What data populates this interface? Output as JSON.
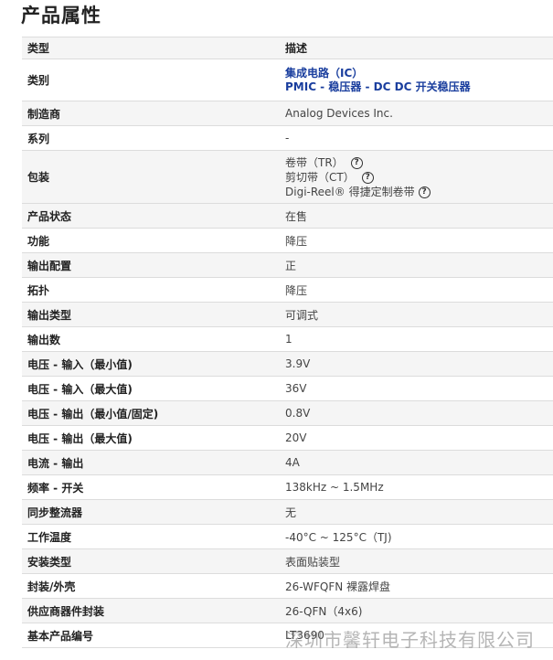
{
  "title": "产品属性",
  "header": {
    "type": "类型",
    "desc": "描述"
  },
  "category": {
    "label": "类别",
    "link1": "集成电路（IC）",
    "link2": "PMIC - 稳压器 - DC DC 开关稳压器"
  },
  "manufacturer": {
    "label": "制造商",
    "value": "Analog Devices Inc."
  },
  "series": {
    "label": "系列",
    "value": "-"
  },
  "packaging": {
    "label": "包装",
    "opt1": "卷带（TR）",
    "opt2": "剪切带（CT）",
    "opt3": "Digi-Reel® 得捷定制卷带"
  },
  "rows": [
    {
      "label": "产品状态",
      "value": "在售"
    },
    {
      "label": "功能",
      "value": "降压"
    },
    {
      "label": "输出配置",
      "value": "正"
    },
    {
      "label": "拓扑",
      "value": "降压"
    },
    {
      "label": "输出类型",
      "value": "可调式"
    },
    {
      "label": "输出数",
      "value": "1"
    },
    {
      "label": "电压 - 输入（最小值)",
      "value": "3.9V"
    },
    {
      "label": "电压 - 输入（最大值)",
      "value": "36V"
    },
    {
      "label": "电压 - 输出（最小值/固定)",
      "value": "0.8V"
    },
    {
      "label": "电压 - 输出（最大值)",
      "value": "20V"
    },
    {
      "label": "电流 - 输出",
      "value": "4A"
    },
    {
      "label": "频率 - 开关",
      "value": "138kHz ~ 1.5MHz"
    },
    {
      "label": "同步整流器",
      "value": "无"
    },
    {
      "label": "工作温度",
      "value": "-40°C ~ 125°C（TJ)"
    },
    {
      "label": "安装类型",
      "value": "表面贴装型"
    },
    {
      "label": "封装/外壳",
      "value": "26-WFQFN 裸露焊盘"
    },
    {
      "label": "供应商器件封装",
      "value": "26-QFN（4x6)"
    },
    {
      "label": "基本产品编号",
      "value": "LT3690"
    }
  ],
  "watermark": "深圳市馨轩电子科技有限公司",
  "help_icon": "question-circle-icon"
}
